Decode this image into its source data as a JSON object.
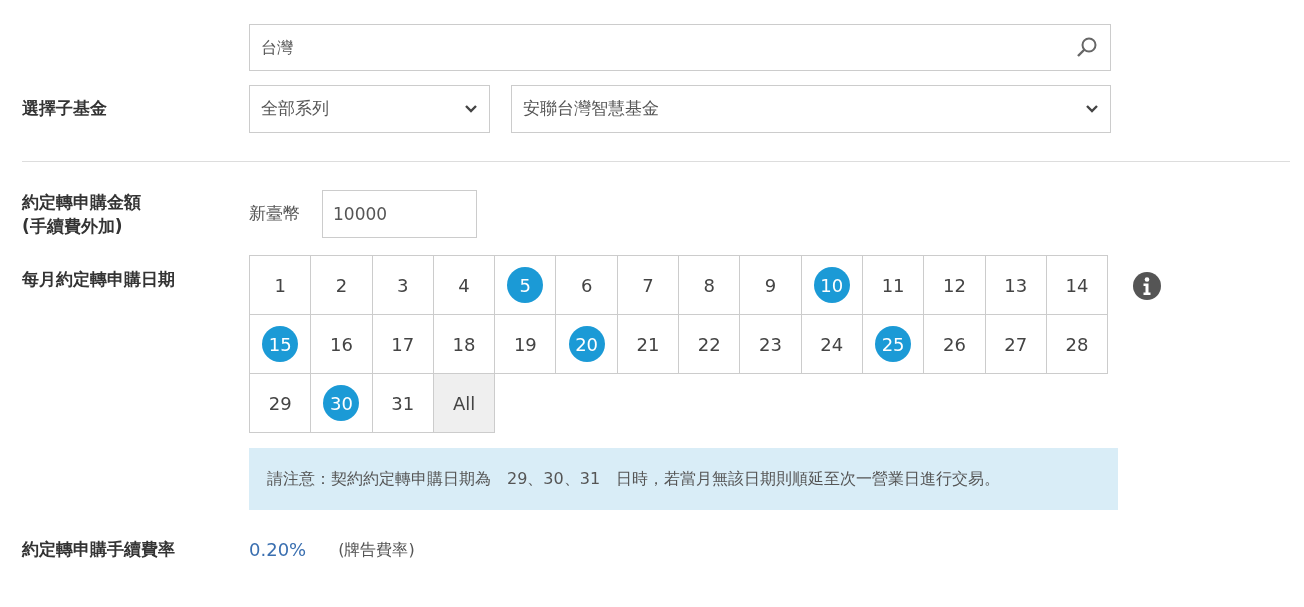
{
  "search": {
    "value": "台灣"
  },
  "sub_fund": {
    "label": "選擇子基金",
    "series_select": {
      "value": "全部系列"
    },
    "fund_select": {
      "value": "安聯台灣智慧基金"
    }
  },
  "amount": {
    "label": "約定轉申購金額",
    "label_note": "(手續費外加)",
    "currency": "新臺幣",
    "value": "10000"
  },
  "dates": {
    "label": "每月約定轉申購日期",
    "days": [
      {
        "label": "1",
        "selected": false
      },
      {
        "label": "2",
        "selected": false
      },
      {
        "label": "3",
        "selected": false
      },
      {
        "label": "4",
        "selected": false
      },
      {
        "label": "5",
        "selected": true
      },
      {
        "label": "6",
        "selected": false
      },
      {
        "label": "7",
        "selected": false
      },
      {
        "label": "8",
        "selected": false
      },
      {
        "label": "9",
        "selected": false
      },
      {
        "label": "10",
        "selected": true
      },
      {
        "label": "11",
        "selected": false
      },
      {
        "label": "12",
        "selected": false
      },
      {
        "label": "13",
        "selected": false
      },
      {
        "label": "14",
        "selected": false
      },
      {
        "label": "15",
        "selected": true
      },
      {
        "label": "16",
        "selected": false
      },
      {
        "label": "17",
        "selected": false
      },
      {
        "label": "18",
        "selected": false
      },
      {
        "label": "19",
        "selected": false
      },
      {
        "label": "20",
        "selected": true
      },
      {
        "label": "21",
        "selected": false
      },
      {
        "label": "22",
        "selected": false
      },
      {
        "label": "23",
        "selected": false
      },
      {
        "label": "24",
        "selected": false
      },
      {
        "label": "25",
        "selected": true
      },
      {
        "label": "26",
        "selected": false
      },
      {
        "label": "27",
        "selected": false
      },
      {
        "label": "28",
        "selected": false
      },
      {
        "label": "29",
        "selected": false
      },
      {
        "label": "30",
        "selected": true
      },
      {
        "label": "31",
        "selected": false
      }
    ],
    "all_button": {
      "label": "All",
      "selected": false
    },
    "note": "請注意：契約約定轉申購日期為　29、30、31　日時，若當月無該日期則順延至次一營業日進行交易。"
  },
  "fee": {
    "label": "約定轉申購手續費率",
    "rate": "0.20%",
    "note": "(牌告費率)"
  }
}
